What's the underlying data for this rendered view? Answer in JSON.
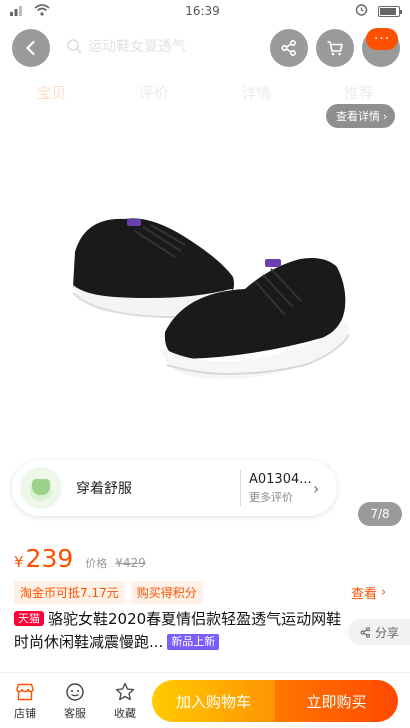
{
  "status_bar": {
    "time": "16:39"
  },
  "header": {
    "search_placeholder": "运动鞋女夏透气",
    "more_badge": "···"
  },
  "tabs": [
    {
      "label": "宝贝"
    },
    {
      "label": "评价"
    },
    {
      "label": "详情"
    },
    {
      "label": "推荐"
    }
  ],
  "gallery": {
    "detail_link": "查看详情",
    "page_counter": "7/8"
  },
  "review": {
    "text": "穿着舒服",
    "product_code": "A01304...",
    "more": "更多评价"
  },
  "price": {
    "currency": "¥",
    "value": "239",
    "old_label": "价格",
    "old_value": "¥429"
  },
  "promos": [
    {
      "label": "淘金币可抵7.17元"
    },
    {
      "label": "购买得积分"
    }
  ],
  "check_link": "查看",
  "title": {
    "tmall_tag": "天猫",
    "text": "骆驼女鞋2020春夏情侣款轻盈透气运动网鞋时尚休闲鞋减震慢跑...",
    "new_tag": "新品上新"
  },
  "share_label": "分享",
  "bottom_bar": {
    "store": "店铺",
    "service": "客服",
    "favorite": "收藏",
    "add_to_cart": "加入购物车",
    "buy_now": "立即购买"
  },
  "colors": {
    "accent": "#ff5000",
    "tmall_red": "#ff0036",
    "cart_gradient": [
      "#ffcb00",
      "#ff9402"
    ],
    "buy_gradient": [
      "#ff7700",
      "#ff4900"
    ]
  }
}
